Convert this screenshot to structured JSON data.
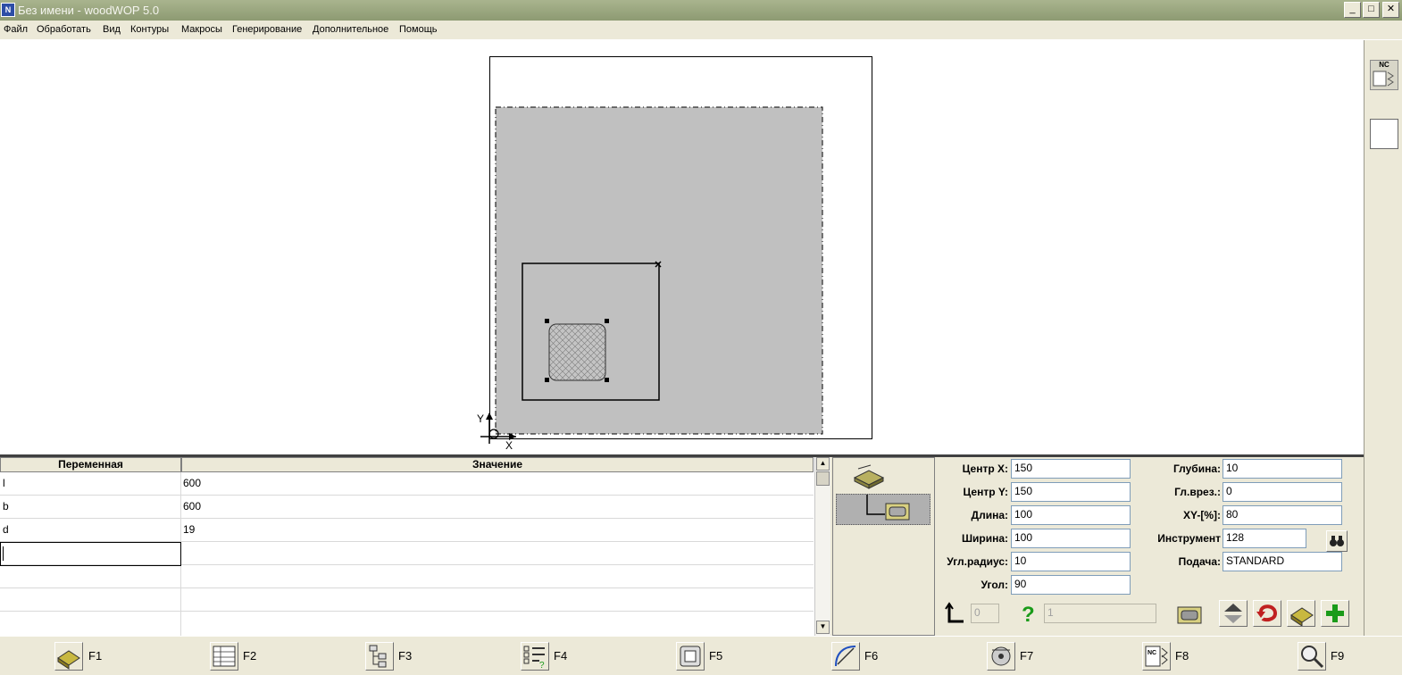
{
  "window": {
    "title": "Без имени - woodWOP 5.0",
    "icon": "woodwop-app-icon"
  },
  "window_controls": {
    "minimize": "_",
    "maximize": "□",
    "close": "✕"
  },
  "menu": [
    "Файл",
    "Обработать",
    "Вид",
    "Контуры",
    "Макросы",
    "Генерирование",
    "Дополнительное",
    "Помощь"
  ],
  "canvas": {
    "axis_y": "Y",
    "axis_x": "X"
  },
  "right_toolbar": {
    "nc_label": "NC"
  },
  "variables": {
    "headers": {
      "name": "Переменная",
      "value": "Значение"
    },
    "rows": [
      {
        "name": "l",
        "value": "600"
      },
      {
        "name": "b",
        "value": "600"
      },
      {
        "name": "d",
        "value": "19"
      }
    ]
  },
  "properties": {
    "left": [
      {
        "label": "Центр X:",
        "value": "150"
      },
      {
        "label": "Центр Y:",
        "value": "150"
      },
      {
        "label": "Длина:",
        "value": "100"
      },
      {
        "label": "Ширина:",
        "value": "100"
      },
      {
        "label": "Угл.радиус:",
        "value": "10"
      },
      {
        "label": "Угол:",
        "value": "90"
      }
    ],
    "right": [
      {
        "label": "Глубина:",
        "value": "10"
      },
      {
        "label": "Гл.врез.:",
        "value": "0"
      },
      {
        "label": "XY-[%]:",
        "value": "80"
      },
      {
        "label": "Инструмент",
        "value": "128"
      },
      {
        "label": "Подача:",
        "value": "STANDARD"
      }
    ],
    "disabled_fields": {
      "first": "0",
      "second": "1"
    }
  },
  "fkeys": [
    "F1",
    "F2",
    "F3",
    "F4",
    "F5",
    "F6",
    "F7",
    "F8",
    "F9"
  ],
  "colors": {
    "titlebar": "#8d9a72",
    "workpiece": "#c0c0c0",
    "background": "#ece9d8"
  }
}
